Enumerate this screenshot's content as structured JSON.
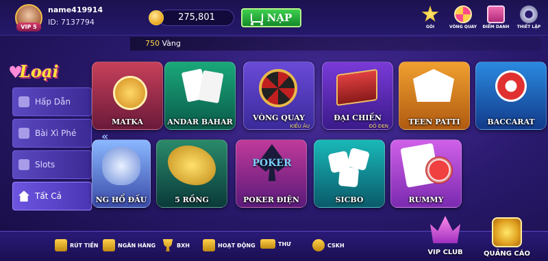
{
  "user": {
    "name": "name419914",
    "id": "ID: 7137794",
    "vip": "VIP 5"
  },
  "balance": {
    "amount": "275,801"
  },
  "nap_label": "NẠP",
  "top_actions": [
    {
      "label": "GÓI",
      "icon": "star-icon"
    },
    {
      "label": "VÒNG QUAY",
      "icon": "wheel-icon"
    },
    {
      "label": "ĐIỂM DANH",
      "icon": "gift-icon"
    },
    {
      "label": "THIẾT LẬP",
      "icon": "gear-icon"
    }
  ],
  "marquee": {
    "amount": "750",
    "unit": "Vàng"
  },
  "categories_title": "Loại",
  "categories": [
    {
      "label": "Hấp Dẫn",
      "icon": "crown-icon"
    },
    {
      "label": "Bài Xì Phé",
      "icon": "cards-icon"
    },
    {
      "label": "Slots",
      "icon": "slot-icon"
    },
    {
      "label": "Tất Cả",
      "icon": "house-icon",
      "active": true
    }
  ],
  "games_row1": [
    {
      "name": "MATKA",
      "sub": ""
    },
    {
      "name": "ANDAR BAHAR",
      "sub": ""
    },
    {
      "name": "VÒNG QUAY",
      "sub": "KIỂU ÂU"
    },
    {
      "name": "ĐẠI CHIẾN",
      "sub": "ĐỎ ĐEN"
    },
    {
      "name": "TEEN PATTI",
      "sub": ""
    },
    {
      "name": "BACCARAT",
      "sub": ""
    }
  ],
  "games_row2": [
    {
      "name": "NG HỔ ĐẤU",
      "sub": ""
    },
    {
      "name": "5 RỒNG",
      "sub": ""
    },
    {
      "name": "POKER ĐIỆN",
      "sub": ""
    },
    {
      "name": "SICBO",
      "sub": ""
    },
    {
      "name": "RUMMY",
      "sub": ""
    }
  ],
  "bottom_nav": [
    {
      "label": "RÚT TIỀN",
      "icon": "withdraw-icon"
    },
    {
      "label": "NGÂN HÀNG",
      "icon": "bank-icon"
    },
    {
      "label": "BXH",
      "icon": "trophy-icon"
    },
    {
      "label": "HOẠT ĐỘNG",
      "icon": "gift-box-icon"
    },
    {
      "label": "THƯ",
      "icon": "mail-icon"
    },
    {
      "label": "CSKH",
      "icon": "phone-24h-icon"
    }
  ],
  "vip_club": "VIP CLUB",
  "quang_cao": "QUẢNG CÁO",
  "poker_logo": "POKER",
  "colors": {
    "accent_gold": "#ffd84a",
    "nap_green": "#2aa83a",
    "panel_purple": "#4a36b4"
  }
}
